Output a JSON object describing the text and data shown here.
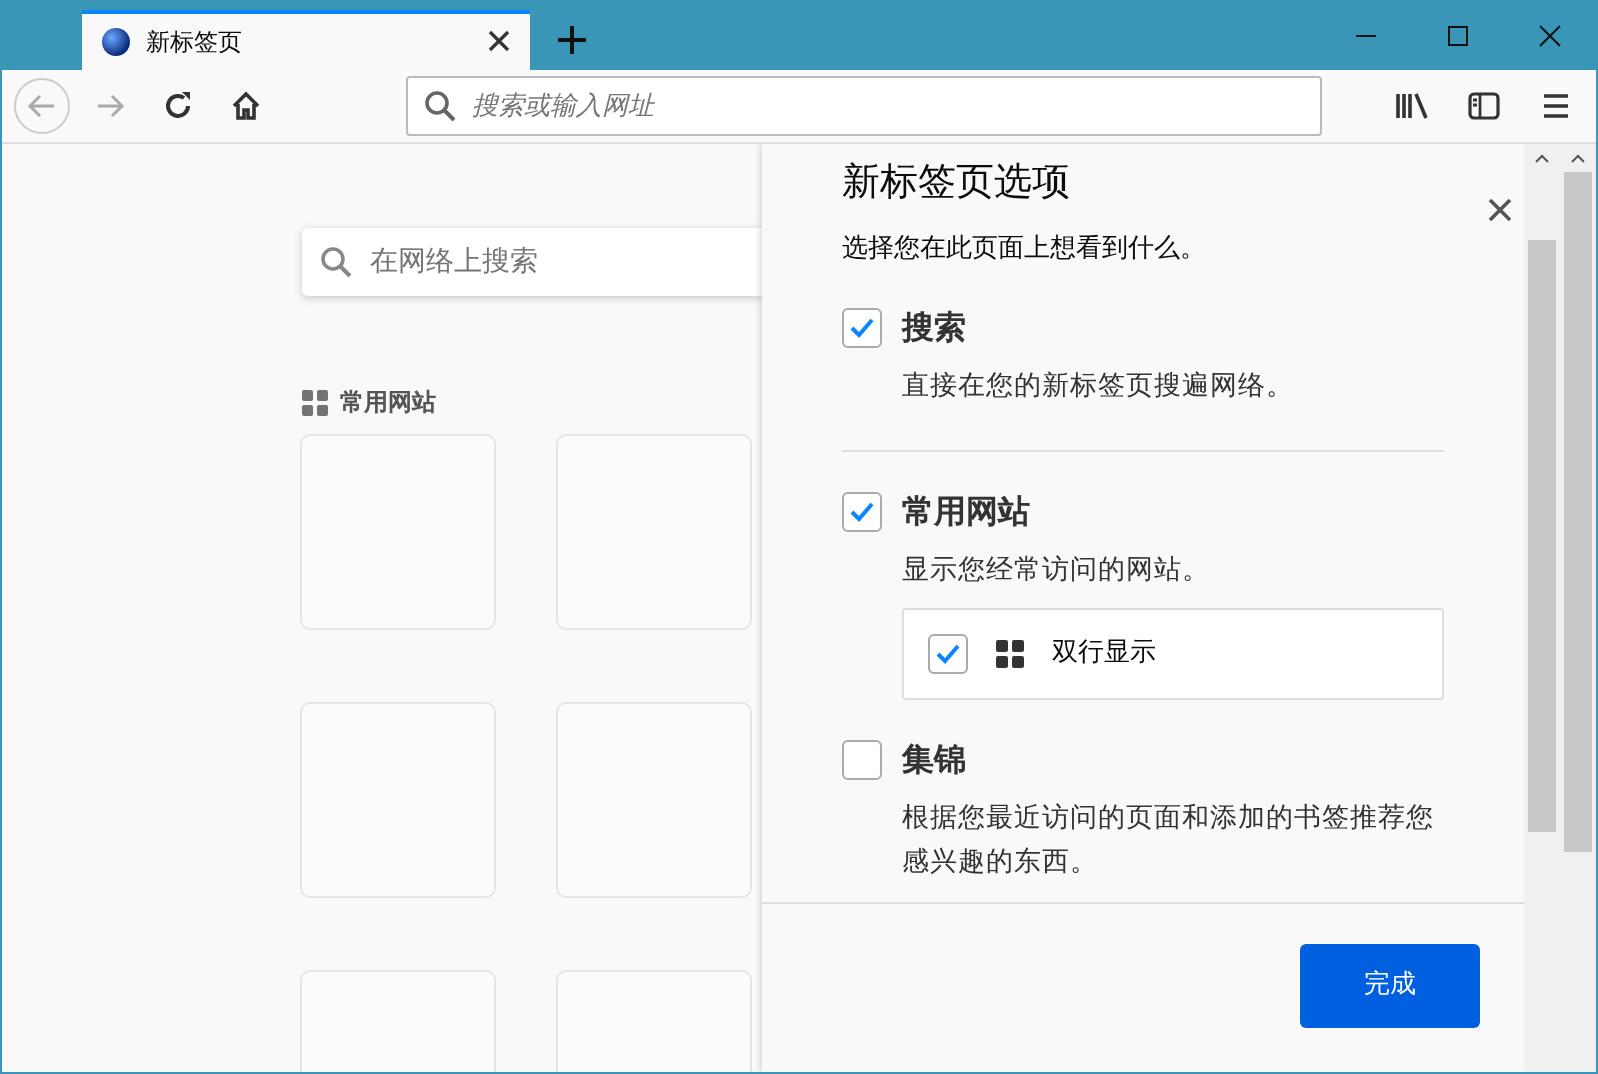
{
  "tabs": [
    {
      "title": "新标签页",
      "selected": true
    }
  ],
  "address_bar": {
    "placeholder": "搜索或输入网址"
  },
  "new_tab_page": {
    "search": {
      "placeholder": "在网络上搜索"
    },
    "top_sites": {
      "heading": "常用网站"
    }
  },
  "customize_panel": {
    "title": "新标签页选项",
    "subtitle": "选择您在此页面上想看到什么。",
    "sections": [
      {
        "label": "搜索",
        "description": "直接在您的新标签页搜遍网络。",
        "checked": true,
        "divider_after": true
      },
      {
        "label": "常用网站",
        "description": "显示您经常访问的网站。",
        "checked": true,
        "sub_option": {
          "label": "双行显示",
          "checked": true
        }
      },
      {
        "label": "集锦",
        "description": "根据您最近访问的页面和添加的书签推荐您感兴趣的东西。",
        "checked": false
      }
    ],
    "done_button": "完成"
  }
}
